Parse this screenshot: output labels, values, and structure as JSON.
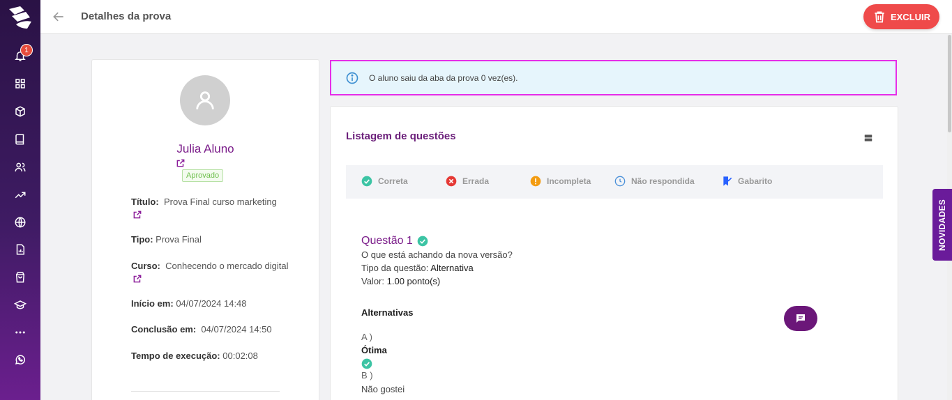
{
  "header": {
    "title": "Detalhes da prova",
    "delete_label": "EXCLUIR"
  },
  "sidebar": {
    "notification_count": "1",
    "items": [
      "bell-icon",
      "grid-icon",
      "box-icon",
      "book-icon",
      "users-icon",
      "trend-icon",
      "globe-icon",
      "report-icon",
      "bag-icon",
      "graduation-icon",
      "more-icon",
      "whatsapp-icon"
    ]
  },
  "novidades": "NOVIDADES",
  "student": {
    "name": "Julia Aluno",
    "status": "Aprovado",
    "titulo_label": "Título:",
    "titulo_value": "Prova Final curso marketing",
    "tipo_label": "Tipo:",
    "tipo_value": "Prova Final",
    "curso_label": "Curso:",
    "curso_value": "Conhecendo o mercado digital",
    "inicio_label": "Início em:",
    "inicio_value": "04/07/2024 14:48",
    "conclusao_label": "Conclusão em:",
    "conclusao_value": "04/07/2024 14:50",
    "tempo_label": "Tempo de execução:",
    "tempo_value": "00:02:08"
  },
  "alert": {
    "text": "O aluno saiu da aba da prova 0 vez(es)."
  },
  "questions": {
    "title": "Listagem de questões",
    "legend": {
      "correct": "Correta",
      "wrong": "Errada",
      "incomplete": "Incompleta",
      "unanswered": "Não respondida",
      "answer_key": "Gabarito"
    },
    "q1": {
      "title": "Questão 1",
      "text": "O que está achando da nova versão?",
      "type_label": "Tipo da questão:",
      "type_value": "Alternativa",
      "value_label": "Valor:",
      "value_value": "1.00 ponto(s)",
      "alternatives_heading": "Alternativas",
      "alt_a_letter": "A )",
      "alt_a_text": "Ótima",
      "alt_b_letter": "B )",
      "alt_b_text": "Não gostei"
    }
  },
  "colors": {
    "brand": "#6b1f7a",
    "danger": "#ef4a4a",
    "correct": "#3cc4a4",
    "wrong": "#e53935",
    "incomplete": "#f39c12",
    "unanswered": "#4a90d9",
    "answer_key": "#2962ff"
  }
}
